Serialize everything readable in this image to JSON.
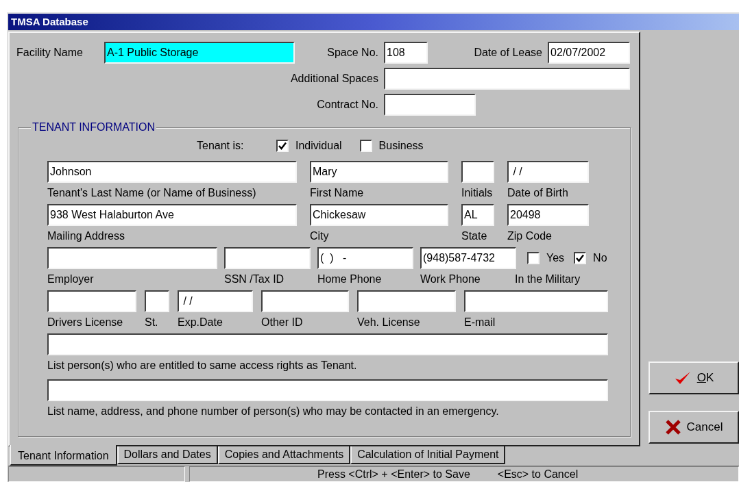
{
  "window": {
    "title": "TMSA Database"
  },
  "lease_fields": [
    {
      "label": "Facility Name",
      "value": "A-1 Public Storage",
      "highlighted": true
    },
    {
      "label": "Space No.",
      "value": "108",
      "highlighted": false
    },
    {
      "label": "Date of Lease",
      "value": "02/07/2002",
      "highlighted": false
    },
    {
      "label": "Additional Spaces",
      "highlighted": false
    },
    {
      "label": "Contract No.",
      "highlighted": false
    }
  ],
  "tenant_information": {
    "title": "TENANT INFORMATION",
    "tenant_is": {
      "label": "Tenant is:",
      "options": [
        {
          "label": "Individual",
          "checked": true
        },
        {
          "label": "Business",
          "checked": false
        }
      ]
    },
    "rows": [
      {
        "fields": [
          {
            "kind": "text",
            "label": "Tenant's Last Name (or Name of Business)",
            "value": "Johnson"
          },
          {
            "kind": "text",
            "label": "First Name",
            "value": "Mary"
          },
          {
            "kind": "text",
            "label": "Initials"
          },
          {
            "kind": "text",
            "label": "Date of Birth",
            "value": " / /"
          }
        ]
      },
      {
        "fields": [
          {
            "kind": "text",
            "label": "Mailing Address",
            "value": "938 West Halaburton Ave"
          },
          {
            "kind": "text",
            "label": "City",
            "value": "Chickesaw"
          },
          {
            "kind": "text",
            "label": "State",
            "value": "AL"
          },
          {
            "kind": "text",
            "label": "Zip Code",
            "value": "20498"
          }
        ]
      },
      {
        "fields": [
          {
            "kind": "text",
            "label": "Employer"
          },
          {
            "kind": "text",
            "label": "SSN /Tax ID"
          },
          {
            "kind": "text",
            "label": "Home Phone",
            "value": "(  )   -"
          },
          {
            "kind": "text",
            "label": "Work Phone",
            "value": "(948)587-4732"
          },
          {
            "kind": "checks",
            "label": "In the Military",
            "options": [
              {
                "label": "Yes",
                "checked": false
              },
              {
                "label": "No",
                "checked": true
              }
            ]
          }
        ]
      },
      {
        "fields": [
          {
            "kind": "text",
            "label": "Drivers License"
          },
          {
            "kind": "text",
            "label": "St."
          },
          {
            "kind": "text",
            "label": "Exp.Date",
            "value": " / /"
          },
          {
            "kind": "text",
            "label": "Other ID"
          },
          {
            "kind": "text",
            "label": "Veh. License"
          },
          {
            "kind": "text",
            "label": "E-mail"
          }
        ]
      }
    ],
    "notes": [
      {
        "label": "List person(s) who are entitled to same access rights as Tenant."
      },
      {
        "label": "List name, address, and phone number of person(s) who may be contacted in an emergency."
      }
    ]
  },
  "tabs": [
    {
      "label": "Tenant Information",
      "selected": true
    },
    {
      "label": "Dollars and Dates",
      "selected": false
    },
    {
      "label": "Copies and Attachments",
      "selected": false
    },
    {
      "label": "Calculation of Initial Payment",
      "selected": false
    }
  ],
  "buttons": [
    {
      "kind": "ok",
      "label": "OK"
    },
    {
      "kind": "cancel",
      "label": "Cancel"
    }
  ],
  "status_bar": {
    "messages": [
      "Press <Ctrl> + <Enter> to Save",
      "<Esc> to Cancel"
    ]
  }
}
